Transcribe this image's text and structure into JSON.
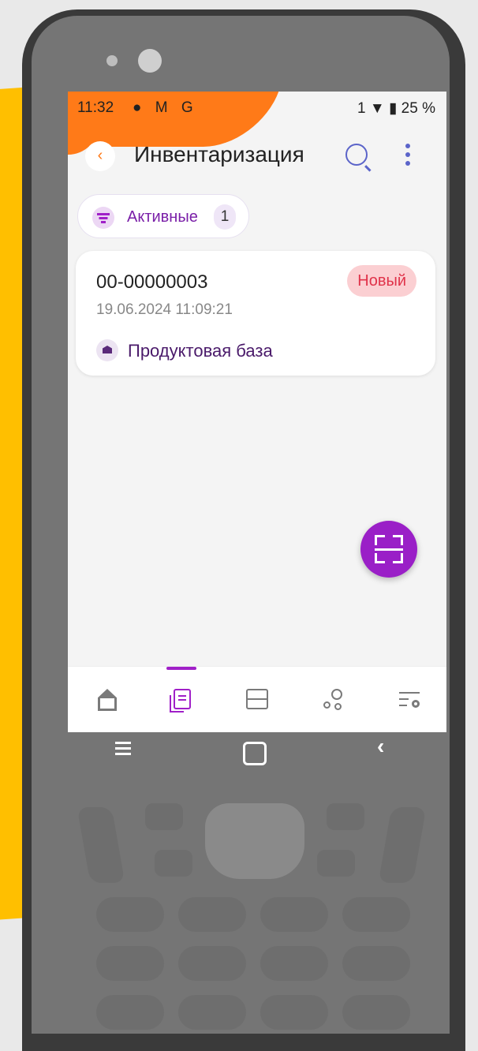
{
  "status_bar": {
    "time": "11:32",
    "notification_icons": "● M G",
    "right": "1 ▼ ▮ 25 %"
  },
  "app_bar": {
    "back_icon": "‹",
    "title": "Инвентаризация"
  },
  "filter": {
    "label": "Активные",
    "count": "1"
  },
  "documents": [
    {
      "number": "00-00000003",
      "date": "19.06.2024 11:09:21",
      "status": "Новый",
      "warehouse": "Продуктовая база"
    }
  ],
  "system_nav": {
    "back": "‹"
  },
  "colors": {
    "accent": "#a020c8",
    "orange": "#ff7a18",
    "status_new_bg": "#fbcfd2",
    "status_new_text": "#e0334a"
  }
}
